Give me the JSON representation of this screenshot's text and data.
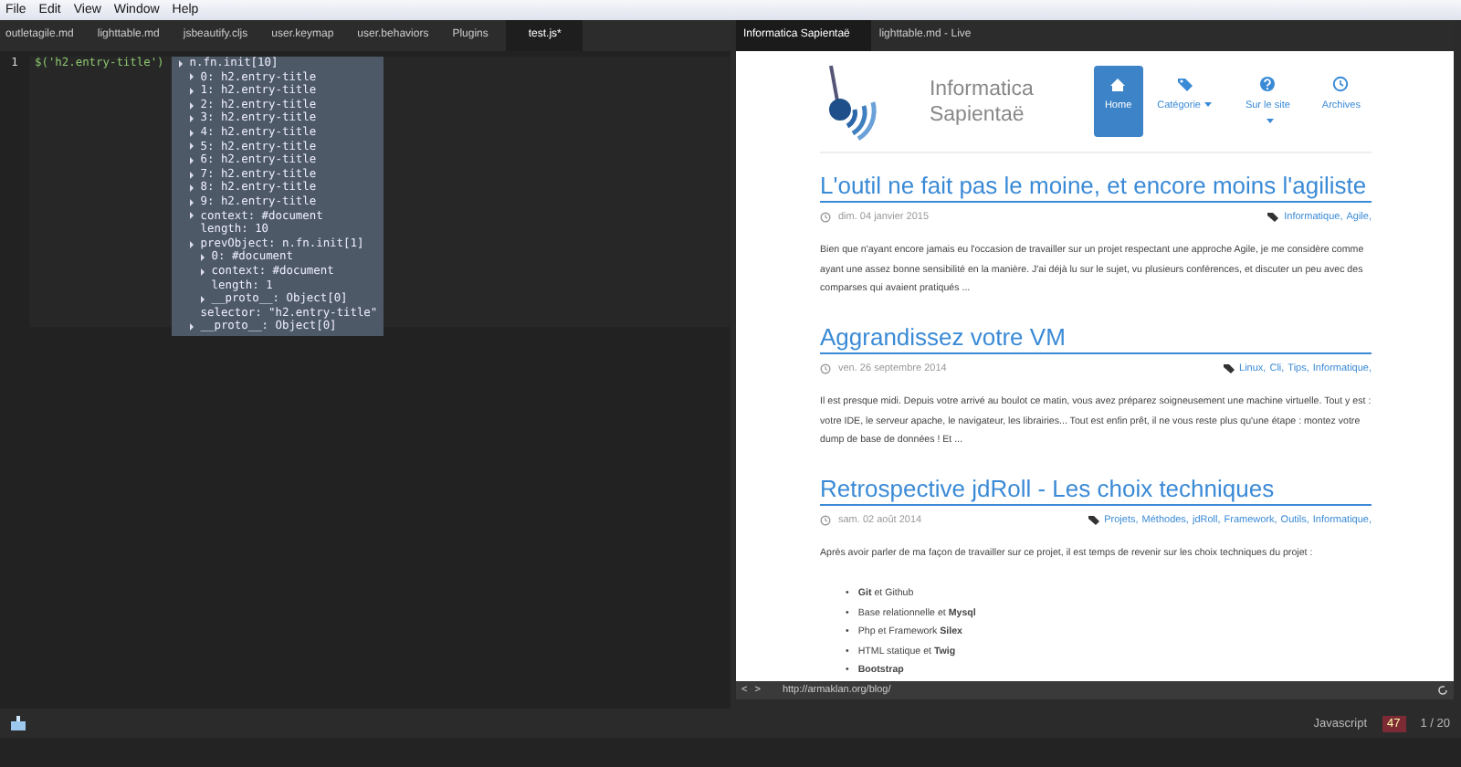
{
  "menu": [
    "File",
    "Edit",
    "View",
    "Window",
    "Help"
  ],
  "editor_tabs": [
    {
      "label": "outletagile.md",
      "selected": false
    },
    {
      "label": "lighttable.md",
      "selected": false
    },
    {
      "label": "jsbeautify.cljs",
      "selected": false
    },
    {
      "label": "user.keymap",
      "selected": false
    },
    {
      "label": "user.behaviors",
      "selected": false
    },
    {
      "label": "Plugins",
      "selected": false
    },
    {
      "label": "test.js*",
      "selected": true
    }
  ],
  "editor": {
    "line_number": "1",
    "code": "$('h2.entry-title')",
    "inspector": [
      {
        "text": "n.fn.init[10]",
        "expandable": true,
        "children": [
          {
            "text": "0: h2.entry-title",
            "expandable": true
          },
          {
            "text": "1: h2.entry-title",
            "expandable": true
          },
          {
            "text": "2: h2.entry-title",
            "expandable": true
          },
          {
            "text": "3: h2.entry-title",
            "expandable": true
          },
          {
            "text": "4: h2.entry-title",
            "expandable": true
          },
          {
            "text": "5: h2.entry-title",
            "expandable": true
          },
          {
            "text": "6: h2.entry-title",
            "expandable": true
          },
          {
            "text": "7: h2.entry-title",
            "expandable": true
          },
          {
            "text": "8: h2.entry-title",
            "expandable": true
          },
          {
            "text": "9: h2.entry-title",
            "expandable": true
          },
          {
            "text": "context: #document",
            "expandable": true
          },
          {
            "text": "length: 10",
            "expandable": false
          },
          {
            "text": "prevObject: n.fn.init[1]",
            "expandable": true,
            "children": [
              {
                "text": "0: #document",
                "expandable": true
              },
              {
                "text": "context: #document",
                "expandable": true
              },
              {
                "text": "length: 1",
                "expandable": false
              },
              {
                "text": "__proto__: Object[0]",
                "expandable": true
              }
            ]
          },
          {
            "text": "selector: \"h2.entry-title\"",
            "expandable": false
          },
          {
            "text": "__proto__: Object[0]",
            "expandable": true
          }
        ]
      }
    ]
  },
  "browser_tabs": [
    {
      "label": "Informatica Sapientaë",
      "selected": true
    },
    {
      "label": "lighttable.md - Live",
      "selected": false
    }
  ],
  "site": {
    "title": "Informatica Sapientaë",
    "nav": [
      {
        "label": "Home",
        "dropdown": false,
        "selected": true
      },
      {
        "label": "Catégorie",
        "dropdown": true,
        "selected": false
      },
      {
        "label": "Sur le site",
        "dropdown": true,
        "selected": false
      },
      {
        "label": "Archives",
        "dropdown": false,
        "selected": false
      }
    ],
    "posts": [
      {
        "title": "L'outil ne fait pas le moine, et encore moins l'agiliste",
        "date": "dim. 04 janvier 2015",
        "tags": [
          "Informatique,",
          "Agile,"
        ],
        "excerpt": "Bien que n'ayant encore jamais eu l'occasion de travailler sur un projet respectant une approche Agile, je me considère comme ayant une assez bonne sensibilité en la manière. J'ai déjà lu sur le sujet, vu plusieurs conférences, et discuter un peu avec des comparses qui avaient pratiqués ..."
      },
      {
        "title": "Aggrandissez votre VM",
        "date": "ven. 26 septembre 2014",
        "tags": [
          "Linux,",
          "Cli,",
          "Tips,",
          "Informatique,"
        ],
        "excerpt": "Il est presque midi. Depuis votre arrivé au boulot ce matin, vous avez préparez soigneusement une machine virtuelle. Tout y est : votre IDE, le serveur apache, le navigateur, les librairies... Tout est enfin prêt, il ne vous reste plus qu'une étape : montez votre dump de base de données ! Et ..."
      },
      {
        "title": "Retrospective jdRoll - Les choix techniques",
        "date": "sam. 02 août 2014",
        "tags": [
          "Projets,",
          "Méthodes,",
          "jdRoll,",
          "Framework,",
          "Outils,",
          "Informatique,"
        ],
        "excerpt": "Après avoir parler de ma façon de travailler sur ce projet, il est temps de revenir sur les choix techniques du projet :",
        "list": [
          {
            "marker": "•",
            "text": "**Git** et Github"
          },
          {
            "marker": "•",
            "text": "Base relationnelle et **Mysql**"
          },
          {
            "marker": "•",
            "text": "Php et Framework **Silex**"
          },
          {
            "marker": "•",
            "text": "HTML statique et **Twig**"
          },
          {
            "marker": "•",
            "text": "**Bootstrap**"
          }
        ]
      }
    ]
  },
  "url_bar": {
    "back": "<",
    "forward": ">",
    "url": "http://armaklan.org/blog/"
  },
  "status_bar": {
    "mode": "Javascript",
    "errors": "47",
    "position": "1 / 20"
  }
}
